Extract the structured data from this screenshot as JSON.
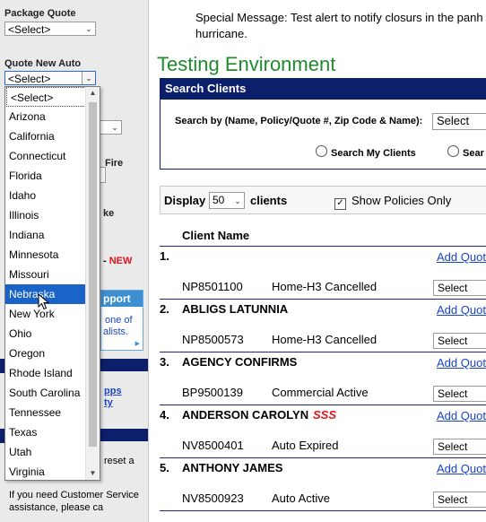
{
  "sidebar": {
    "package_quote_label": "Package Quote",
    "package_quote_value": "<Select>",
    "quote_new_auto_label": "Quote New Auto",
    "quote_new_auto_value": "<Select>",
    "partial_fire": "Fire",
    "partial_ke": "ke",
    "partial_new_prefix": "-",
    "partial_new": "NEW",
    "promo_title": "pport",
    "promo_line1": "one of",
    "promo_line2": "alists.",
    "partial_link1": "pps",
    "partial_link2": "ty",
    "partial_reset": "reset a",
    "customer_service_line1": "If you need Customer Service",
    "customer_service_line2": "assistance, please ca"
  },
  "dropdown": {
    "options": [
      "<Select>",
      "Arizona",
      "California",
      "Connecticut",
      "Florida",
      "Idaho",
      "Illinois",
      "Indiana",
      "Minnesota",
      "Missouri",
      "Nebraska",
      "New York",
      "Ohio",
      "Oregon",
      "Rhode Island",
      "South Carolina",
      "Tennessee",
      "Texas",
      "Utah",
      "Virginia"
    ],
    "highlighted": "Nebraska"
  },
  "main": {
    "special_message_line1": "Special Message: Test alert to notify closurs in the panh",
    "special_message_line2": "hurricane.",
    "environment_title": "Testing Environment",
    "search_clients_title": "Search Clients",
    "search_by_label": "Search by (Name, Policy/Quote #, Zip Code & Name):",
    "search_by_value": "Select",
    "radio_my_clients": "Search My Clients",
    "radio_other": "Sear",
    "display_label": "Display",
    "display_value": "50",
    "clients_label": "clients",
    "show_policies_label": "Show Policies Only",
    "client_name_header": "Client Name"
  },
  "clients": [
    {
      "num": "1.",
      "name": "",
      "flag": "",
      "policy": "NP8501100",
      "description": "Home-H3 Cancelled",
      "add_quote": "Add Quot",
      "select": "Select"
    },
    {
      "num": "2.",
      "name": "ABLIGS LATUNNIA",
      "flag": "",
      "policy": "NP8500573",
      "description": "Home-H3 Cancelled",
      "add_quote": "Add Quot",
      "select": "Select"
    },
    {
      "num": "3.",
      "name": "AGENCY CONFIRMS",
      "flag": "",
      "policy": "BP9500139",
      "description": "Commercial Active",
      "add_quote": "Add Quot",
      "select": "Select"
    },
    {
      "num": "4.",
      "name": "ANDERSON CAROLYN",
      "flag": "SSS",
      "policy": "NV8500401",
      "description": "Auto Expired",
      "add_quote": "Add Quot",
      "select": "Select"
    },
    {
      "num": "5.",
      "name": "ANTHONY JAMES",
      "flag": "",
      "policy": "NV8500923",
      "description": "Auto Active",
      "add_quote": "Add Quot",
      "select": "Select"
    }
  ],
  "colors": {
    "title_green": "#1f8a2e",
    "nav_blue": "#0c1f6b",
    "highlight": "#1a64c8",
    "flag_red": "#e0141e"
  }
}
